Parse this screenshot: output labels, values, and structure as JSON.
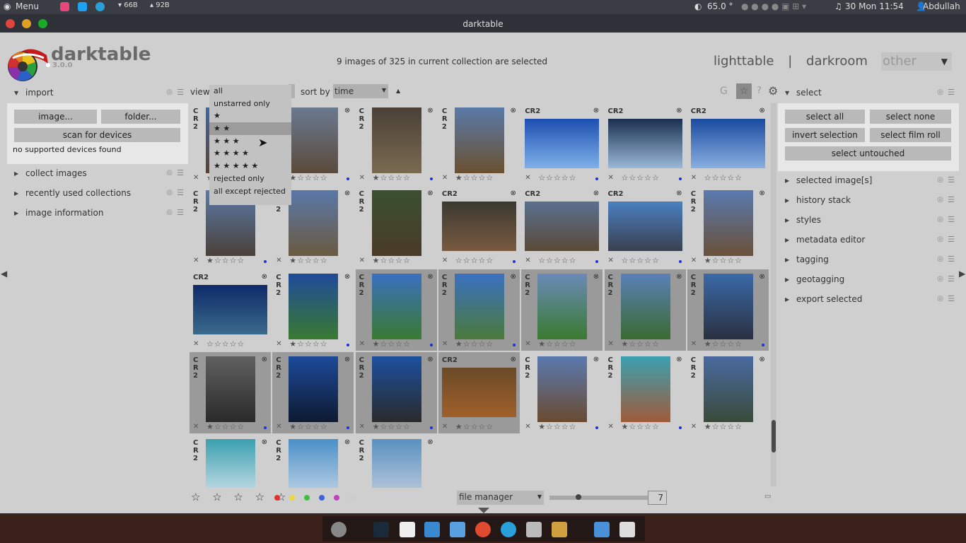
{
  "topbar": {
    "menu": "Menu",
    "net_down": "66B",
    "net_up": "92B",
    "temp": "65.0 °",
    "clock": "30 Mon 11:54",
    "user": "Abdullah",
    "icons": [
      "app-menu-icon",
      "instagram-icon",
      "twitter-icon",
      "telegram-icon",
      "network-icon",
      "temperature-icon",
      "bluetooth-icon",
      "cloud-icon",
      "wifi-icon",
      "music-icon"
    ]
  },
  "window": {
    "title": "darktable"
  },
  "header": {
    "app_name": "darktable",
    "version": "3.0.0",
    "selection_info": "9 images of 325 in current collection are selected",
    "view_lighttable": "lighttable",
    "view_darkroom": "darkroom",
    "view_other": "other",
    "separator": "|"
  },
  "left": {
    "import": {
      "title": "import",
      "image_button": "image...",
      "folder_button": "folder...",
      "scan_button": "scan for devices",
      "status": "no supported devices found"
    },
    "modules": [
      {
        "title": "collect images"
      },
      {
        "title": "recently used collections"
      },
      {
        "title": "image information"
      }
    ]
  },
  "center": {
    "view_label": "view",
    "sort_label": "sort by",
    "sort_value": "time",
    "sort_dir": "▲",
    "tool_g": "G",
    "tool_star": "☆",
    "tool_help": "?",
    "dropdown": [
      "all",
      "unstarred only",
      "★",
      "★ ★",
      "★ ★ ★",
      "★ ★ ★ ★",
      "★ ★ ★ ★ ★",
      "rejected only",
      "all except rejected"
    ],
    "dropdown_selected": 3,
    "layout_value": "file manager",
    "zoom_value": "7",
    "stars_filter": "☆ ☆ ☆ ☆ ☆",
    "color_labels": [
      "#e03030",
      "#e8d840",
      "#40c040",
      "#4060e0",
      "#c040c0",
      "#cccccc"
    ],
    "thumbs": [
      {
        "ext": "CR2",
        "stars": 1,
        "sel": false,
        "dot": true,
        "orient": "p",
        "c1": "#3d6aa8",
        "c2": "#5a4030"
      },
      {
        "ext": "CR2",
        "stars": 1,
        "sel": false,
        "dot": true,
        "orient": "p",
        "c1": "#6a7a90",
        "c2": "#5a4a3a"
      },
      {
        "ext": "CR2",
        "stars": 1,
        "sel": false,
        "dot": true,
        "orient": "p",
        "c1": "#4a4038",
        "c2": "#7a6a50"
      },
      {
        "ext": "CR2",
        "stars": 1,
        "sel": false,
        "dot": false,
        "orient": "p",
        "c1": "#5a7aa8",
        "c2": "#6a5030"
      },
      {
        "ext": "CR2",
        "stars": 0,
        "sel": false,
        "dot": true,
        "orient": "l",
        "c1": "#1c4fb0",
        "c2": "#7fb0e8"
      },
      {
        "ext": "CR2",
        "stars": 0,
        "sel": false,
        "dot": true,
        "orient": "l",
        "c1": "#1a3050",
        "c2": "#9ab8d8"
      },
      {
        "ext": "CR2",
        "stars": 0,
        "sel": false,
        "dot": false,
        "orient": "l",
        "c1": "#1a4aa0",
        "c2": "#8ab0e0"
      },
      {
        "ext": "CR2",
        "stars": 1,
        "sel": false,
        "dot": true,
        "orient": "p",
        "c1": "#5a7aa8",
        "c2": "#4a4038"
      },
      {
        "ext": "CR2",
        "stars": 1,
        "sel": false,
        "dot": false,
        "orient": "p",
        "c1": "#5a78a8",
        "c2": "#6a5a40"
      },
      {
        "ext": "CR2",
        "stars": 1,
        "sel": false,
        "dot": false,
        "orient": "p",
        "c1": "#3a5030",
        "c2": "#4a3a28"
      },
      {
        "ext": "CR2",
        "stars": 0,
        "sel": false,
        "dot": true,
        "orient": "l",
        "c1": "#3a3a30",
        "c2": "#7a5a40"
      },
      {
        "ext": "CR2",
        "stars": 0,
        "sel": false,
        "dot": true,
        "orient": "l",
        "c1": "#5a7090",
        "c2": "#5a4a38"
      },
      {
        "ext": "CR2",
        "stars": 0,
        "sel": false,
        "dot": true,
        "orient": "l",
        "c1": "#4a80c0",
        "c2": "#3a4050"
      },
      {
        "ext": "CR2",
        "stars": 1,
        "sel": false,
        "dot": false,
        "orient": "p",
        "c1": "#5a7ab0",
        "c2": "#6a5038"
      },
      {
        "ext": "CR2",
        "stars": 0,
        "sel": false,
        "dot": false,
        "orient": "l",
        "c1": "#0e2a6a",
        "c2": "#3a6a8a"
      },
      {
        "ext": "CR2",
        "stars": 1,
        "sel": false,
        "dot": true,
        "orient": "p",
        "c1": "#1f4a9a",
        "c2": "#3a7a30"
      },
      {
        "ext": "CR2",
        "stars": 1,
        "sel": true,
        "dot": true,
        "orient": "p",
        "c1": "#3a70c0",
        "c2": "#3a7a30"
      },
      {
        "ext": "CR2",
        "stars": 1,
        "sel": true,
        "dot": true,
        "orient": "p",
        "c1": "#3a70c0",
        "c2": "#4a7a3a"
      },
      {
        "ext": "CR2",
        "stars": 1,
        "sel": true,
        "dot": false,
        "orient": "p",
        "c1": "#6a8ab8",
        "c2": "#3a7a30"
      },
      {
        "ext": "CR2",
        "stars": 1,
        "sel": true,
        "dot": false,
        "orient": "p",
        "c1": "#5a80b8",
        "c2": "#3a6a30"
      },
      {
        "ext": "CR2",
        "stars": 1,
        "sel": true,
        "dot": true,
        "orient": "p",
        "c1": "#3a6aa8",
        "c2": "#2a3040"
      },
      {
        "ext": "CR2",
        "stars": 1,
        "sel": true,
        "dot": true,
        "orient": "p",
        "c1": "#606060",
        "c2": "#2a2a2a"
      },
      {
        "ext": "CR2",
        "stars": 1,
        "sel": true,
        "dot": true,
        "orient": "p",
        "c1": "#1c4a9a",
        "c2": "#0e1a30"
      },
      {
        "ext": "CR2",
        "stars": 1,
        "sel": true,
        "dot": true,
        "orient": "p",
        "c1": "#1c50a0",
        "c2": "#2a2a2a"
      },
      {
        "ext": "CR2",
        "stars": 1,
        "sel": true,
        "dot": false,
        "orient": "l",
        "c1": "#6a4a28",
        "c2": "#a0602a"
      },
      {
        "ext": "CR2",
        "stars": 1,
        "sel": false,
        "dot": true,
        "orient": "p",
        "c1": "#5a7ab0",
        "c2": "#6a4a30"
      },
      {
        "ext": "CR2",
        "stars": 1,
        "sel": false,
        "dot": true,
        "orient": "p",
        "c1": "#3aa0b0",
        "c2": "#a05a3a"
      },
      {
        "ext": "CR2",
        "stars": 1,
        "sel": false,
        "dot": false,
        "orient": "p",
        "c1": "#4a6aa0",
        "c2": "#3a4a3a"
      },
      {
        "ext": "CR2",
        "stars": 0,
        "sel": false,
        "dot": false,
        "orient": "p",
        "c1": "#3aa0b0",
        "c2": "#e0e8f0"
      },
      {
        "ext": "CR2",
        "stars": 0,
        "sel": false,
        "dot": false,
        "orient": "p",
        "c1": "#4a90c8",
        "c2": "#d0dcea"
      },
      {
        "ext": "CR2",
        "stars": 0,
        "sel": false,
        "dot": false,
        "orient": "p",
        "c1": "#5a90c0",
        "c2": "#c8d4e0"
      }
    ]
  },
  "right": {
    "select": {
      "title": "select",
      "select_all": "select all",
      "select_none": "select none",
      "invert": "invert selection",
      "film_roll": "select film roll",
      "untouched": "select untouched"
    },
    "modules": [
      {
        "title": "selected image[s]"
      },
      {
        "title": "history stack"
      },
      {
        "title": "styles"
      },
      {
        "title": "metadata editor"
      },
      {
        "title": "tagging"
      },
      {
        "title": "geotagging"
      },
      {
        "title": "export selected"
      }
    ]
  },
  "dock": {
    "icons": [
      "chrome-icon",
      "terminal-icon",
      "editor-icon",
      "files-icon",
      "folder-icon",
      "browser-icon",
      "telegram-icon",
      "typora-icon",
      "darktable-icon",
      "folder2-icon",
      "tool-icon"
    ]
  }
}
